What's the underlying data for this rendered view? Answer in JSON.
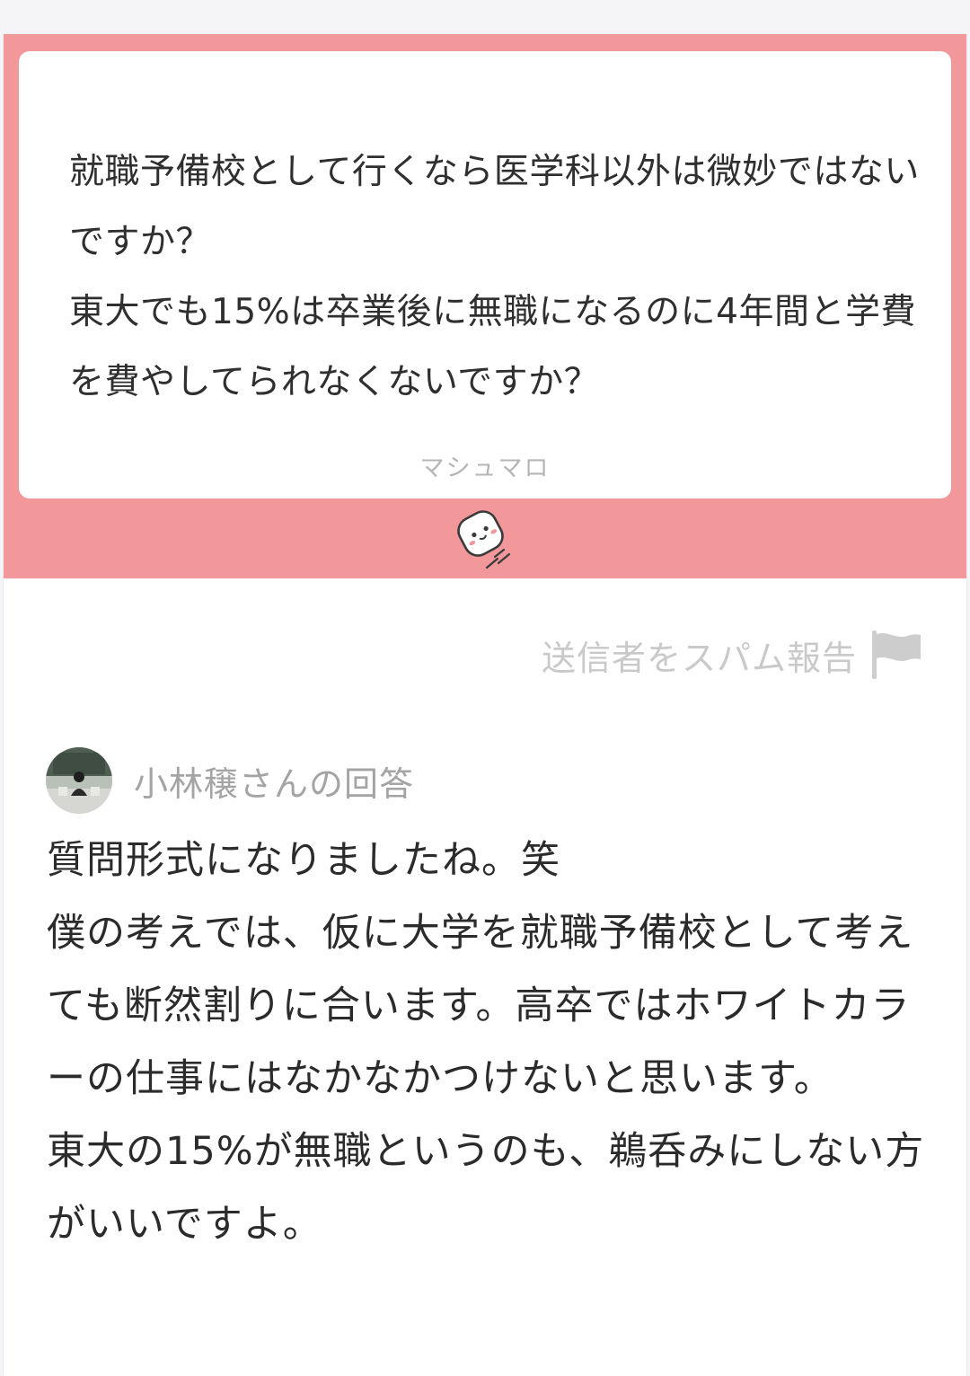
{
  "question": {
    "text": "就職予備校として行くなら医学科以外は微妙ではないですか？\n東大でも15%は卒業後に無職になるのに4年間と学費を費やしてられなくないですか？",
    "brand_label": "マシュマロ"
  },
  "report": {
    "label": "送信者をスパム報告",
    "icon": "flag-icon"
  },
  "answer": {
    "author_label": "小林穣さんの回答",
    "text": "質問形式になりましたね。笑\n僕の考えでは、仮に大学を就職予備校として考えても断然割りに合います。高卒ではホワイトカラーの仕事にはなかなかつけないと思います。\n東大の15%が無職というのも、鵜呑みにしない方がいいですよ。"
  },
  "colors": {
    "accent": "#f2979a",
    "background": "#f5f5f7",
    "card": "#ffffff",
    "muted_text": "#a4a4a4",
    "body_text": "#2b2b2b"
  }
}
